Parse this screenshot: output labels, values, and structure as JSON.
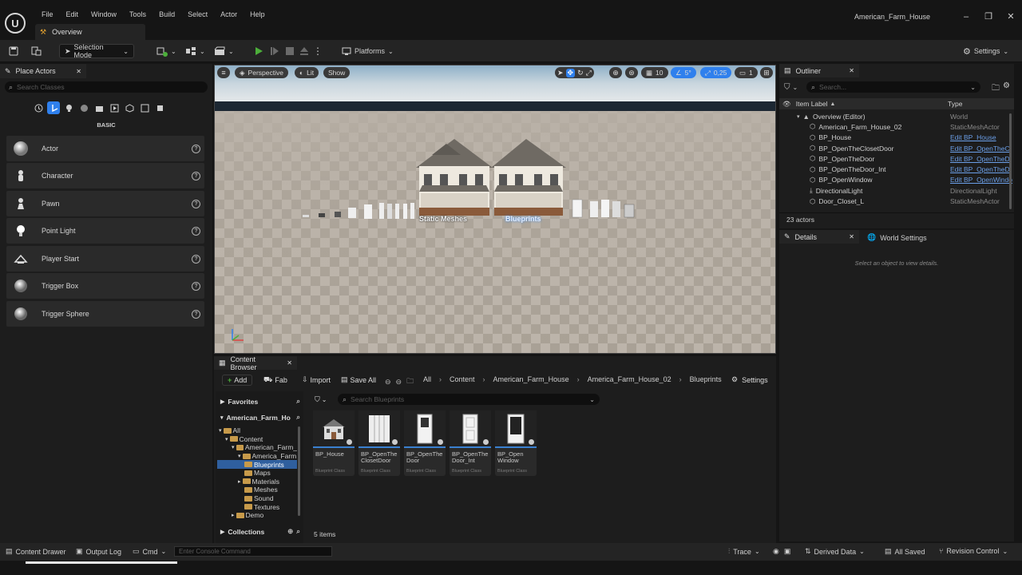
{
  "menu": [
    "File",
    "Edit",
    "Window",
    "Tools",
    "Build",
    "Select",
    "Actor",
    "Help"
  ],
  "document_tab": "Overview",
  "project_title": "American_Farm_House",
  "toolbar": {
    "selection_mode": "Selection Mode",
    "platforms": "Platforms",
    "settings": "Settings"
  },
  "place_actors": {
    "tab": "Place Actors",
    "search_placeholder": "Search Classes",
    "category": "BASIC",
    "items": [
      {
        "label": "Actor",
        "icon": "sphere-icon"
      },
      {
        "label": "Character",
        "icon": "character-icon"
      },
      {
        "label": "Pawn",
        "icon": "pawn-icon"
      },
      {
        "label": "Point Light",
        "icon": "light-bulb-icon"
      },
      {
        "label": "Player Start",
        "icon": "player-start-icon"
      },
      {
        "label": "Trigger Box",
        "icon": "trigger-box-icon"
      },
      {
        "label": "Trigger Sphere",
        "icon": "trigger-sphere-icon"
      }
    ]
  },
  "viewport": {
    "perspective": "Perspective",
    "lit": "Lit",
    "show": "Show",
    "grid_snap": "10",
    "rotation_snap": "5°",
    "scale_snap": "0,25",
    "camera_speed": "1",
    "label_static": "Static Meshes",
    "label_bp": "Blueprints"
  },
  "outliner": {
    "tab": "Outliner",
    "search_placeholder": "Search...",
    "col_label": "Item Label",
    "col_type": "Type",
    "rows": [
      {
        "label": "Overview (Editor)",
        "type": "World",
        "link": false
      },
      {
        "label": "American_Farm_House_02",
        "type": "StaticMeshActor",
        "link": false
      },
      {
        "label": "BP_House",
        "type": "Edit BP_House",
        "link": true
      },
      {
        "label": "BP_OpenTheClosetDoor",
        "type": "Edit BP_OpenTheC",
        "link": true
      },
      {
        "label": "BP_OpenTheDoor",
        "type": "Edit BP_OpenTheD",
        "link": true
      },
      {
        "label": "BP_OpenTheDoor_Int",
        "type": "Edit BP_OpenTheD",
        "link": true
      },
      {
        "label": "BP_OpenWindow",
        "type": "Edit BP_OpenWindo",
        "link": true
      },
      {
        "label": "DirectionalLight",
        "type": "DirectionalLight",
        "link": false
      },
      {
        "label": "Door_Closet_L",
        "type": "StaticMeshActor",
        "link": false
      }
    ],
    "count": "23 actors"
  },
  "details": {
    "tab": "Details",
    "world_settings_tab": "World Settings",
    "empty_hint": "Select an object to view details."
  },
  "content_browser": {
    "tab": "Content Browser",
    "add": "Add",
    "fab": "Fab",
    "import": "Import",
    "save_all": "Save All",
    "settings": "Settings",
    "breadcrumbs": [
      "All",
      "Content",
      "American_Farm_House",
      "America_Farm_House_02",
      "Blueprints"
    ],
    "favorites": "Favorites",
    "root": "American_Farm_Ho",
    "collections": "Collections",
    "search_placeholder": "Search Blueprints",
    "tree": [
      "All",
      "Content",
      "American_Farm_",
      "America_Farm",
      "Blueprints",
      "Maps",
      "Materials",
      "Meshes",
      "Sound",
      "Textures",
      "Demo"
    ],
    "assets": [
      {
        "name": "BP_House",
        "cls": "Blueprint Class"
      },
      {
        "name": "BP_OpenThe ClosetDoor",
        "cls": "Blueprint Class"
      },
      {
        "name": "BP_OpenThe Door",
        "cls": "Blueprint Class"
      },
      {
        "name": "BP_OpenThe Door_Int",
        "cls": "Blueprint Class"
      },
      {
        "name": "BP_Open Window",
        "cls": "Blueprint Class"
      }
    ],
    "item_count": "5 items"
  },
  "statusbar": {
    "content_drawer": "Content Drawer",
    "output_log": "Output Log",
    "cmd": "Cmd",
    "console_placeholder": "Enter Console Command",
    "trace": "Trace",
    "derived_data": "Derived Data",
    "all_saved": "All Saved",
    "revision_control": "Revision Control"
  },
  "colors": {
    "accent": "#2f80ed",
    "play": "#4caf3a",
    "link": "#6b9fe8",
    "panel": "#1d1d1d"
  }
}
